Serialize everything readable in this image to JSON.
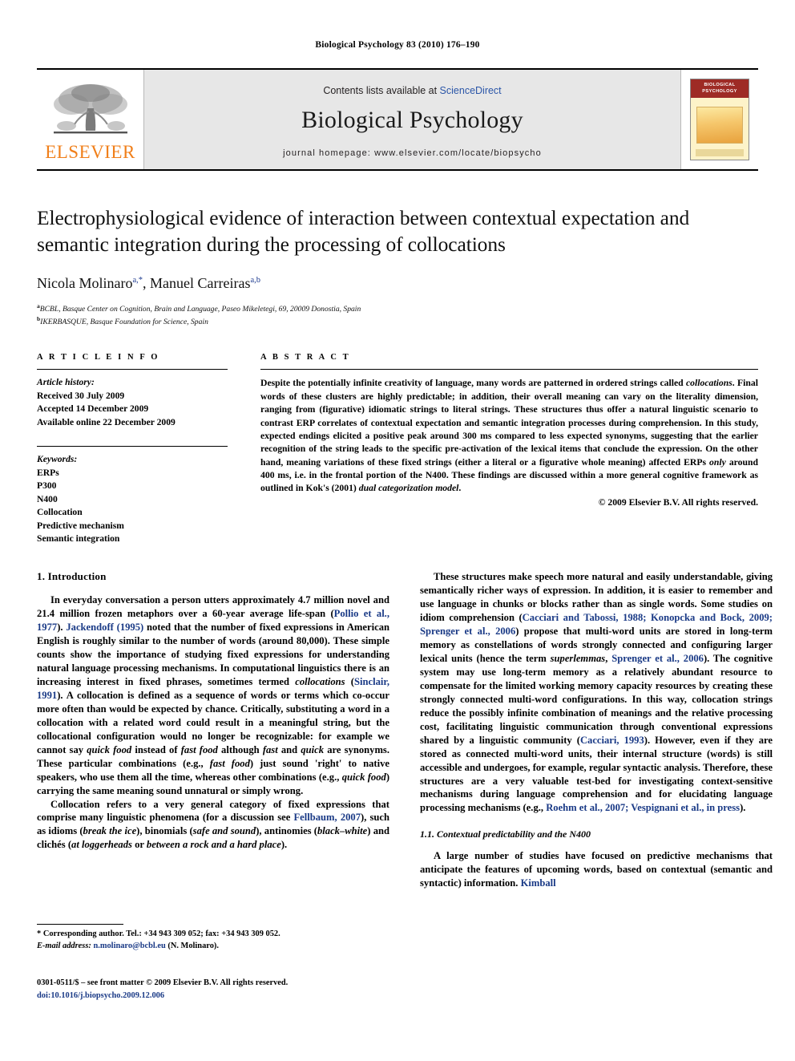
{
  "running_head": "Biological Psychology 83 (2010) 176–190",
  "masthead": {
    "publisher_name": "ELSEVIER",
    "contents_prefix": "Contents lists available at ",
    "contents_link": "ScienceDirect",
    "journal_title": "Biological Psychology",
    "homepage": "journal homepage: www.elsevier.com/locate/biopsycho",
    "cover_title_line1": "BIOLOGICAL",
    "cover_title_line2": "PSYCHOLOGY"
  },
  "title": "Electrophysiological evidence of interaction between contextual expectation and semantic integration during the processing of collocations",
  "authors": [
    {
      "name": "Nicola Molinaro",
      "marks": "a,*"
    },
    {
      "name": "Manuel Carreiras",
      "marks": "a,b"
    }
  ],
  "affiliations": [
    {
      "mark": "a",
      "text": "BCBL, Basque Center on Cognition, Brain and Language, Paseo Mikeletegi, 69, 20009 Donostia, Spain"
    },
    {
      "mark": "b",
      "text": "IKERBASQUE, Basque Foundation for Science, Spain"
    }
  ],
  "article_info": {
    "heading": "A R T I C L E  I N F O",
    "history_label": "Article history:",
    "history": [
      "Received 30 July 2009",
      "Accepted 14 December 2009",
      "Available online 22 December 2009"
    ],
    "keywords_label": "Keywords:",
    "keywords": [
      "ERPs",
      "P300",
      "N400",
      "Collocation",
      "Predictive mechanism",
      "Semantic integration"
    ]
  },
  "abstract": {
    "heading": "A B S T R A C T",
    "p1_a": "Despite the potentially infinite creativity of language, many words are patterned in ordered strings called ",
    "p1_i1": "collocations",
    "p1_b": ". Final words of these clusters are highly predictable; in addition, their overall meaning can vary on the literality dimension, ranging from (figurative) idiomatic strings to literal strings. These structures thus offer a natural linguistic scenario to contrast ERP correlates of contextual expectation and semantic integration processes during comprehension. In this study, expected endings elicited a positive peak around 300 ms compared to less expected synonyms, suggesting that the earlier recognition of the string leads to the specific pre-activation of the lexical items that conclude the expression. On the other hand, meaning variations of these fixed strings (either a literal or a figurative whole meaning) affected ERPs ",
    "p1_i2": "only",
    "p1_c": " around 400 ms, i.e. in the frontal portion of the N400. These findings are discussed within a more general cognitive framework as outlined in Kok's (2001) ",
    "p1_i3": "dual categorization model",
    "p1_d": ".",
    "copyright": "© 2009 Elsevier B.V. All rights reserved."
  },
  "sections": {
    "intro_heading": "1. Introduction",
    "subsec_heading": "1.1. Contextual predictability and the N400"
  },
  "left_column": {
    "p1_a": "In everyday conversation a person utters approximately 4.7 million novel and 21.4 million frozen metaphors over a 60-year average life-span (",
    "p1_cite1": "Pollio et al., 1977",
    "p1_b": "). ",
    "p1_cite2": "Jackendoff (1995)",
    "p1_c": " noted that the number of fixed expressions in American English is roughly similar to the number of words (around 80,000). These simple counts show the importance of studying fixed expressions for understanding natural language processing mechanisms. In computational linguistics there is an increasing interest in fixed phrases, sometimes termed ",
    "p1_i1": "collocations",
    "p1_d": " (",
    "p1_cite3": "Sinclair, 1991",
    "p1_e": "). A collocation is defined as a sequence of words or terms which co-occur more often than would be expected by chance. Critically, substituting a word in a collocation with a related word could result in a meaningful string, but the collocational configuration would no longer be recognizable: for example we cannot say ",
    "p1_i2": "quick food",
    "p1_f": " instead of ",
    "p1_i3": "fast food",
    "p1_g": " although ",
    "p1_i4": "fast",
    "p1_h": " and ",
    "p1_i5": "quick",
    "p1_i": " are synonyms. These particular combinations (e.g., ",
    "p1_i6": "fast food",
    "p1_j": ") just sound 'right' to native speakers, who use them all the time, whereas other combinations (e.g., ",
    "p1_i7": "quick food",
    "p1_k": ") carrying the same meaning sound unnatural or simply wrong.",
    "p2_a": "Collocation refers to a very general category of fixed expressions that comprise many linguistic phenomena (for a discussion see ",
    "p2_cite1": "Fellbaum, 2007",
    "p2_b": "), such as idioms (",
    "p2_i1": "break the ice",
    "p2_c": "), binomials (",
    "p2_i2": "safe and sound",
    "p2_d": "), antinomies (",
    "p2_i3": "black–white",
    "p2_e": ") and clichés (",
    "p2_i4": "at loggerheads",
    "p2_f": " or ",
    "p2_i5": "between a rock and a hard place",
    "p2_g": ")."
  },
  "right_column": {
    "p1_a": "These structures make speech more natural and easily understandable, giving semantically richer ways of expression. In addition, it is easier to remember and use language in chunks or blocks rather than as single words. Some studies on idiom comprehension (",
    "p1_cite1": "Cacciari and Tabossi, 1988; Konopcka and Bock, 2009; Sprenger et al., 2006",
    "p1_b": ") propose that multi-word units are stored in long-term memory as constellations of words strongly connected and configuring larger lexical units (hence the term ",
    "p1_i1": "superlemmas",
    "p1_c": ", ",
    "p1_cite2": "Sprenger et al., 2006",
    "p1_d": "). The cognitive system may use long-term memory as a relatively abundant resource to compensate for the limited working memory capacity resources by creating these strongly connected multi-word configurations. In this way, collocation strings reduce the possibly infinite combination of meanings and the relative processing cost, facilitating linguistic communication through conventional expressions shared by a linguistic community (",
    "p1_cite3": "Cacciari, 1993",
    "p1_e": "). However, even if they are stored as connected multi-word units, their internal structure (words) is still accessible and undergoes, for example, regular syntactic analysis. Therefore, these structures are a very valuable test-bed for investigating context-sensitive mechanisms during language comprehension and for elucidating language processing mechanisms (e.g., ",
    "p1_cite4": "Roehm et al., 2007; Vespignani et al., in press",
    "p1_f": ").",
    "p2_a": "A large number of studies have focused on predictive mechanisms that anticipate the features of upcoming words, based on contextual (semantic and syntactic) information. ",
    "p2_cite1": "Kimball"
  },
  "footnote": {
    "marker": "*",
    "corresponding": "Corresponding author. Tel.: +34 943 309 052; fax: +34 943 309 052.",
    "email_label": "E-mail address:",
    "email": "n.molinaro@bcbl.eu",
    "email_suffix": "(N. Molinaro)."
  },
  "footer": {
    "line1": "0301-0511/$ – see front matter © 2009 Elsevier B.V. All rights reserved.",
    "doi_label": "doi:",
    "doi": "10.1016/j.biopsycho.2009.12.006"
  },
  "colors": {
    "link": "#2b56a8",
    "citation": "#1a3a86",
    "elsevier_orange": "#f07f1a",
    "masthead_bg": "#e7e7e7"
  }
}
